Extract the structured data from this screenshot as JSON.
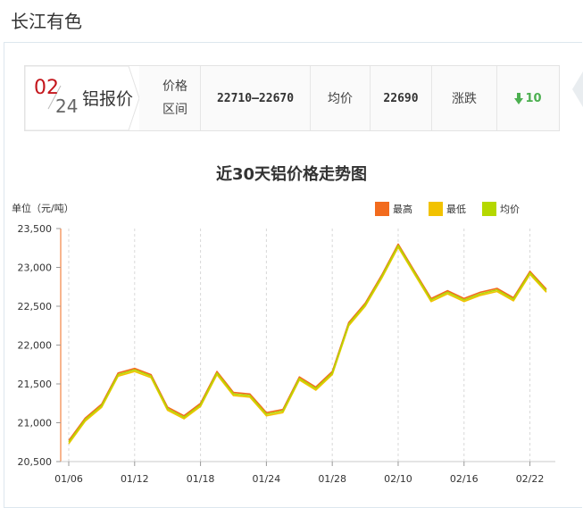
{
  "site": {
    "title": "长江有色"
  },
  "header": {
    "month": "02",
    "day": "24",
    "title": "铝报价",
    "price_label_line1": "价格",
    "price_label_line2": "区间",
    "price_range": "22710–22670",
    "avg_label": "均价",
    "avg_value": "22690",
    "change_label": "涨跌",
    "change_value": "10",
    "change_direction": "down",
    "colors": {
      "month": "#c4161c",
      "change": "#4caf50"
    }
  },
  "chart_data": {
    "type": "line",
    "title": "近30天铝价格走势图",
    "ylabel": "单位（元/吨）",
    "ylim": [
      20500,
      23500
    ],
    "yticks": [
      "20,500",
      "21,000",
      "21,500",
      "22,000",
      "22,500",
      "23,000",
      "23,500"
    ],
    "ytick_values": [
      20500,
      21000,
      21500,
      22000,
      22500,
      23000,
      23500
    ],
    "x": [
      "01/06",
      "01/07",
      "01/10",
      "01/11",
      "01/12",
      "01/13",
      "01/14",
      "01/17",
      "01/18",
      "01/19",
      "01/20",
      "01/21",
      "01/24",
      "01/25",
      "01/26",
      "01/27",
      "01/28",
      "02/07",
      "02/08",
      "02/09",
      "02/10",
      "02/11",
      "02/14",
      "02/15",
      "02/16",
      "02/17",
      "02/18",
      "02/21",
      "02/22",
      "02/23"
    ],
    "xtick_labels": [
      "01/06",
      "01/12",
      "01/18",
      "01/24",
      "01/28",
      "02/10",
      "02/16",
      "02/22"
    ],
    "xtick_indices": [
      0,
      4,
      8,
      12,
      16,
      20,
      24,
      28
    ],
    "series": [
      {
        "name": "最高",
        "color": "#f26b1d",
        "values": [
          20770,
          21060,
          21240,
          21640,
          21700,
          21620,
          21200,
          21090,
          21250,
          21660,
          21390,
          21370,
          21130,
          21170,
          21590,
          21460,
          21660,
          22290,
          22540,
          22900,
          23300,
          22950,
          22600,
          22700,
          22600,
          22680,
          22730,
          22610,
          22950,
          22720
        ]
      },
      {
        "name": "最低",
        "color": "#f2c200",
        "values": [
          20730,
          21020,
          21200,
          21600,
          21660,
          21580,
          21160,
          21050,
          21210,
          21620,
          21350,
          21330,
          21090,
          21130,
          21550,
          21420,
          21620,
          22250,
          22500,
          22860,
          23260,
          22910,
          22560,
          22660,
          22560,
          22640,
          22690,
          22570,
          22910,
          22680
        ]
      },
      {
        "name": "均价",
        "color": "#b5d800",
        "values": [
          20750,
          21040,
          21220,
          21620,
          21680,
          21600,
          21180,
          21070,
          21230,
          21640,
          21370,
          21350,
          21110,
          21150,
          21570,
          21440,
          21640,
          22270,
          22520,
          22880,
          23280,
          22930,
          22580,
          22680,
          22580,
          22660,
          22710,
          22590,
          22930,
          22700
        ]
      }
    ],
    "grid": "vertical-dashed",
    "legend_position": "top-right"
  }
}
